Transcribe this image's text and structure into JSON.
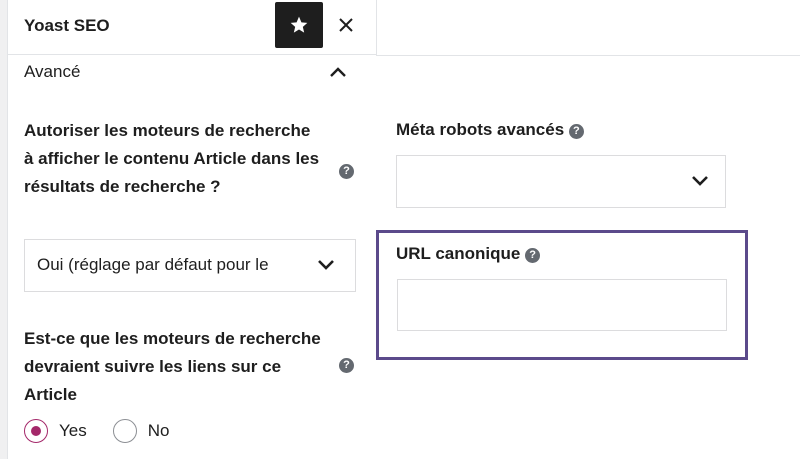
{
  "header": {
    "title": "Yoast SEO",
    "star_icon": "star-icon",
    "close_icon": "close-icon"
  },
  "section": {
    "title": "Avancé",
    "toggle_icon": "chevron-up-icon"
  },
  "search_visibility": {
    "label": "Autoriser les moteurs de recherche à afficher le contenu Article dans les résultats de recherche ?",
    "help": "?",
    "selected_value": "Oui (réglage par défaut pour le"
  },
  "follow_links": {
    "label": "Est-ce que les moteurs de recherche devraient suivre les liens sur ce Article",
    "help": "?",
    "options": [
      {
        "label": "Yes",
        "checked": true
      },
      {
        "label": "No",
        "checked": false
      }
    ]
  },
  "meta_robots": {
    "label": "Méta robots avancés",
    "help": "?",
    "selected_value": ""
  },
  "canonical": {
    "label": "URL canonique",
    "help": "?",
    "value": "",
    "placeholder": ""
  },
  "colors": {
    "accent": "#a4286a",
    "highlight_border": "#5b4a8b",
    "dark_button": "#1e1e1e"
  }
}
